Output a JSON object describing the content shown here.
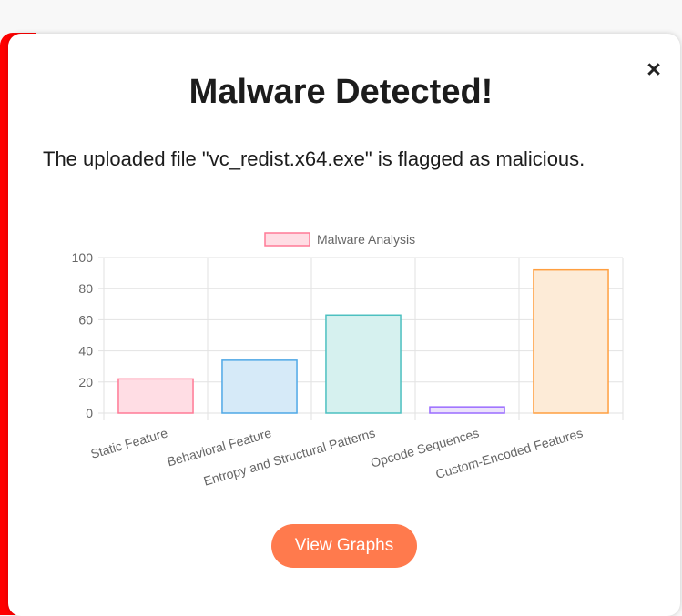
{
  "modal": {
    "title": "Malware Detected!",
    "message": "The uploaded file \"vc_redist.x64.exe\" is flagged as malicious.",
    "close_icon": "×",
    "view_button_label": "View Graphs",
    "accent_color": "#ff0000",
    "button_color": "#ff7a4d"
  },
  "chart_data": {
    "type": "bar",
    "categories": [
      "Static Feature",
      "Behavioral Feature",
      "Entropy and Structural Patterns",
      "Opcode Sequences",
      "Custom-Encoded Features"
    ],
    "series": [
      {
        "name": "Malware Analysis",
        "values": [
          22,
          34,
          63,
          4,
          92
        ]
      }
    ],
    "ylim": [
      0,
      100
    ],
    "yticks": [
      0,
      20,
      40,
      60,
      80,
      100
    ],
    "grid": true,
    "legend": "top-center",
    "bar_fill_colors": [
      "#ffdde4",
      "#d6eaf8",
      "#d6f1ef",
      "#ebe2fb",
      "#fdebd7"
    ],
    "bar_border_colors": [
      "#ff7a96",
      "#4fa8e6",
      "#4cc0c0",
      "#9a6cff",
      "#ff9f40"
    ],
    "legend_fill": "#ffdde4",
    "legend_border": "#ff7a96"
  }
}
